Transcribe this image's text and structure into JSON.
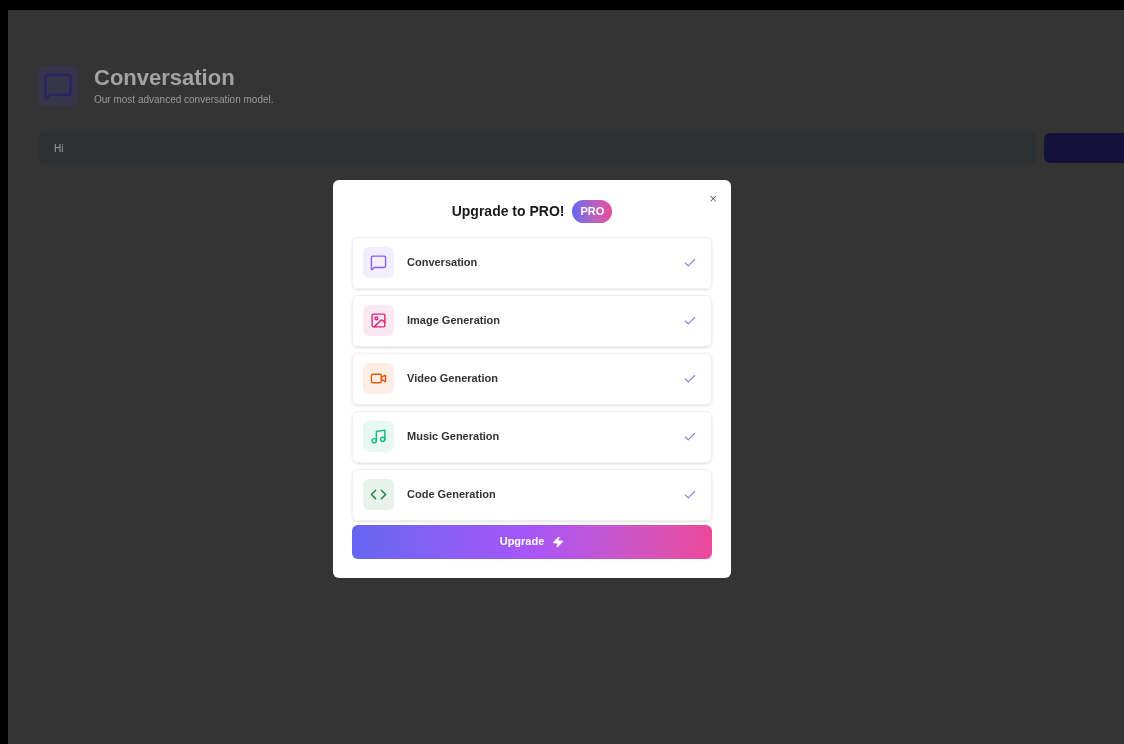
{
  "page": {
    "title": "Conversation",
    "subtitle": "Our most advanced conversation model.",
    "prompt": {
      "value": "Hi"
    }
  },
  "modal": {
    "title": "Upgrade to PRO!",
    "badge": "PRO",
    "close": "×",
    "features": [
      {
        "label": "Conversation",
        "kind": "chat",
        "color": "#8b5cf6",
        "checked": true
      },
      {
        "label": "Image Generation",
        "kind": "image",
        "color": "#db2777",
        "checked": true
      },
      {
        "label": "Video Generation",
        "kind": "video",
        "color": "#ea580c",
        "checked": true
      },
      {
        "label": "Music Generation",
        "kind": "music",
        "color": "#10b981",
        "checked": true
      },
      {
        "label": "Code Generation",
        "kind": "code",
        "color": "#15803d",
        "checked": true
      }
    ],
    "button": "Upgrade"
  }
}
